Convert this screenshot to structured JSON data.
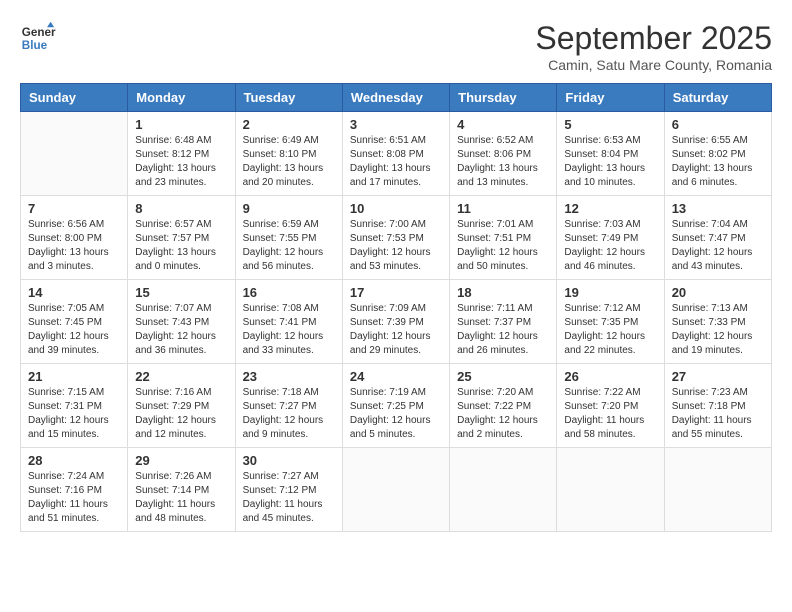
{
  "header": {
    "logo_line1": "General",
    "logo_line2": "Blue",
    "month_title": "September 2025",
    "location": "Camin, Satu Mare County, Romania"
  },
  "weekdays": [
    "Sunday",
    "Monday",
    "Tuesday",
    "Wednesday",
    "Thursday",
    "Friday",
    "Saturday"
  ],
  "weeks": [
    [
      {
        "day": "",
        "info": ""
      },
      {
        "day": "1",
        "info": "Sunrise: 6:48 AM\nSunset: 8:12 PM\nDaylight: 13 hours\nand 23 minutes."
      },
      {
        "day": "2",
        "info": "Sunrise: 6:49 AM\nSunset: 8:10 PM\nDaylight: 13 hours\nand 20 minutes."
      },
      {
        "day": "3",
        "info": "Sunrise: 6:51 AM\nSunset: 8:08 PM\nDaylight: 13 hours\nand 17 minutes."
      },
      {
        "day": "4",
        "info": "Sunrise: 6:52 AM\nSunset: 8:06 PM\nDaylight: 13 hours\nand 13 minutes."
      },
      {
        "day": "5",
        "info": "Sunrise: 6:53 AM\nSunset: 8:04 PM\nDaylight: 13 hours\nand 10 minutes."
      },
      {
        "day": "6",
        "info": "Sunrise: 6:55 AM\nSunset: 8:02 PM\nDaylight: 13 hours\nand 6 minutes."
      }
    ],
    [
      {
        "day": "7",
        "info": "Sunrise: 6:56 AM\nSunset: 8:00 PM\nDaylight: 13 hours\nand 3 minutes."
      },
      {
        "day": "8",
        "info": "Sunrise: 6:57 AM\nSunset: 7:57 PM\nDaylight: 13 hours\nand 0 minutes."
      },
      {
        "day": "9",
        "info": "Sunrise: 6:59 AM\nSunset: 7:55 PM\nDaylight: 12 hours\nand 56 minutes."
      },
      {
        "day": "10",
        "info": "Sunrise: 7:00 AM\nSunset: 7:53 PM\nDaylight: 12 hours\nand 53 minutes."
      },
      {
        "day": "11",
        "info": "Sunrise: 7:01 AM\nSunset: 7:51 PM\nDaylight: 12 hours\nand 50 minutes."
      },
      {
        "day": "12",
        "info": "Sunrise: 7:03 AM\nSunset: 7:49 PM\nDaylight: 12 hours\nand 46 minutes."
      },
      {
        "day": "13",
        "info": "Sunrise: 7:04 AM\nSunset: 7:47 PM\nDaylight: 12 hours\nand 43 minutes."
      }
    ],
    [
      {
        "day": "14",
        "info": "Sunrise: 7:05 AM\nSunset: 7:45 PM\nDaylight: 12 hours\nand 39 minutes."
      },
      {
        "day": "15",
        "info": "Sunrise: 7:07 AM\nSunset: 7:43 PM\nDaylight: 12 hours\nand 36 minutes."
      },
      {
        "day": "16",
        "info": "Sunrise: 7:08 AM\nSunset: 7:41 PM\nDaylight: 12 hours\nand 33 minutes."
      },
      {
        "day": "17",
        "info": "Sunrise: 7:09 AM\nSunset: 7:39 PM\nDaylight: 12 hours\nand 29 minutes."
      },
      {
        "day": "18",
        "info": "Sunrise: 7:11 AM\nSunset: 7:37 PM\nDaylight: 12 hours\nand 26 minutes."
      },
      {
        "day": "19",
        "info": "Sunrise: 7:12 AM\nSunset: 7:35 PM\nDaylight: 12 hours\nand 22 minutes."
      },
      {
        "day": "20",
        "info": "Sunrise: 7:13 AM\nSunset: 7:33 PM\nDaylight: 12 hours\nand 19 minutes."
      }
    ],
    [
      {
        "day": "21",
        "info": "Sunrise: 7:15 AM\nSunset: 7:31 PM\nDaylight: 12 hours\nand 15 minutes."
      },
      {
        "day": "22",
        "info": "Sunrise: 7:16 AM\nSunset: 7:29 PM\nDaylight: 12 hours\nand 12 minutes."
      },
      {
        "day": "23",
        "info": "Sunrise: 7:18 AM\nSunset: 7:27 PM\nDaylight: 12 hours\nand 9 minutes."
      },
      {
        "day": "24",
        "info": "Sunrise: 7:19 AM\nSunset: 7:25 PM\nDaylight: 12 hours\nand 5 minutes."
      },
      {
        "day": "25",
        "info": "Sunrise: 7:20 AM\nSunset: 7:22 PM\nDaylight: 12 hours\nand 2 minutes."
      },
      {
        "day": "26",
        "info": "Sunrise: 7:22 AM\nSunset: 7:20 PM\nDaylight: 11 hours\nand 58 minutes."
      },
      {
        "day": "27",
        "info": "Sunrise: 7:23 AM\nSunset: 7:18 PM\nDaylight: 11 hours\nand 55 minutes."
      }
    ],
    [
      {
        "day": "28",
        "info": "Sunrise: 7:24 AM\nSunset: 7:16 PM\nDaylight: 11 hours\nand 51 minutes."
      },
      {
        "day": "29",
        "info": "Sunrise: 7:26 AM\nSunset: 7:14 PM\nDaylight: 11 hours\nand 48 minutes."
      },
      {
        "day": "30",
        "info": "Sunrise: 7:27 AM\nSunset: 7:12 PM\nDaylight: 11 hours\nand 45 minutes."
      },
      {
        "day": "",
        "info": ""
      },
      {
        "day": "",
        "info": ""
      },
      {
        "day": "",
        "info": ""
      },
      {
        "day": "",
        "info": ""
      }
    ]
  ]
}
